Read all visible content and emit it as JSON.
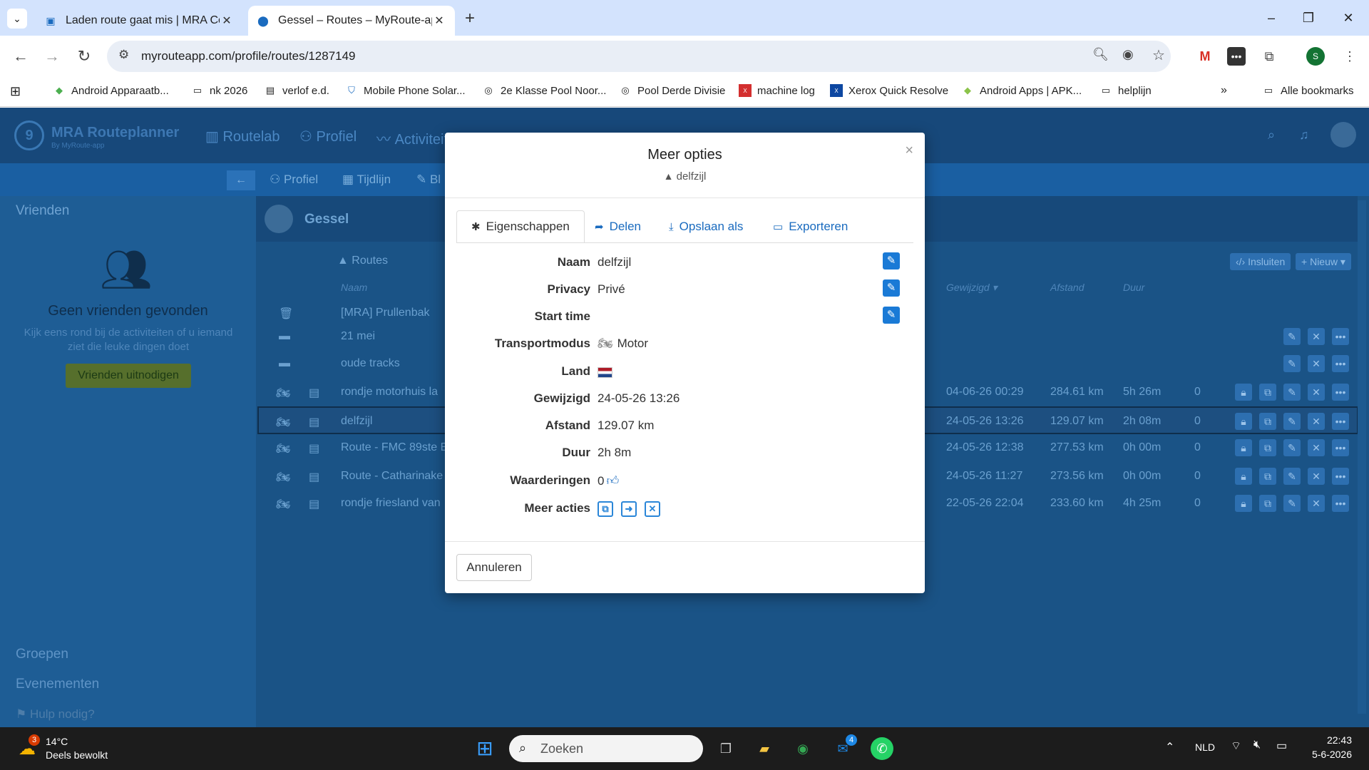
{
  "browser": {
    "tabs": [
      {
        "title": "Laden route gaat mis | MRA Co",
        "active": false
      },
      {
        "title": "Gessel – Routes – MyRoute-app",
        "active": true
      }
    ],
    "url": "myrouteapp.com/profile/routes/1287149",
    "profile_initial": "S",
    "bookmarks": [
      {
        "label": "Android Apparaatb...",
        "icon": "android-icon"
      },
      {
        "label": "nk 2026",
        "icon": "folder-icon"
      },
      {
        "label": "verlof e.d.",
        "icon": "doc-icon"
      },
      {
        "label": "Mobile Phone Solar...",
        "icon": "shield-icon"
      },
      {
        "label": "2e Klasse Pool Noor...",
        "icon": "pool-icon"
      },
      {
        "label": "Pool Derde Divisie",
        "icon": "pool-icon"
      },
      {
        "label": "machine log",
        "icon": "xerox-icon"
      },
      {
        "label": "Xerox Quick Resolve",
        "icon": "xerox-icon"
      },
      {
        "label": "Android Apps | APK...",
        "icon": "android-icon"
      },
      {
        "label": "helplijn",
        "icon": "folder-icon"
      }
    ],
    "all_bookmarks": "Alle bookmarks"
  },
  "app": {
    "logo_title": "MRA Routeplanner",
    "logo_sub": "By MyRoute-app",
    "nav": [
      "Routelab",
      "Profiel",
      "Activiteit"
    ],
    "subnav": [
      "Profiel",
      "Tijdlijn",
      "Bl"
    ],
    "sidebar": {
      "friends_header": "Vrienden",
      "no_friends_title": "Geen vrienden gevonden",
      "no_friends_text": "Kijk eens rond bij de activiteiten of u iemand ziet die leuke dingen doet",
      "invite_button": "Vrienden uitnodigen",
      "groups": "Groepen",
      "events": "Evenementen",
      "help": "Hulp nodig?"
    },
    "profile_name": "Gessel",
    "routes_header": "Routes",
    "toolbar": {
      "embed": "Insluiten",
      "new": "Nieuw"
    },
    "columns": {
      "name": "Naam",
      "modified": "Gewijzigd",
      "distance": "Afstand",
      "duration": "Duur"
    },
    "rows": [
      {
        "name": "[MRA] Prullenbak",
        "type": "trash",
        "modified": "",
        "distance": "",
        "duration": "",
        "likes": ""
      },
      {
        "name": "21 mei",
        "type": "folder",
        "modified": "",
        "distance": "",
        "duration": "",
        "likes": ""
      },
      {
        "name": "oude tracks",
        "type": "folder",
        "modified": "",
        "distance": "",
        "duration": "",
        "likes": ""
      },
      {
        "name": "rondje motorhuis la",
        "type": "route",
        "modified": "04-06-26 00:29",
        "distance": "284.61 km",
        "duration": "5h 26m",
        "likes": "0"
      },
      {
        "name": "delfzijl",
        "type": "route",
        "modified": "24-05-26 13:26",
        "distance": "129.07 km",
        "duration": "2h 08m",
        "likes": "0"
      },
      {
        "name": "Route - FMC 89ste E",
        "type": "route",
        "modified": "24-05-26 12:38",
        "distance": "277.53 km",
        "duration": "0h 00m",
        "likes": "0"
      },
      {
        "name": "Route - Catharinake",
        "type": "route",
        "modified": "24-05-26 11:27",
        "distance": "273.56 km",
        "duration": "0h 00m",
        "likes": "0"
      },
      {
        "name": "rondje friesland van",
        "type": "route",
        "modified": "22-05-26 22:04",
        "distance": "233.60 km",
        "duration": "4h 25m",
        "likes": "0"
      }
    ]
  },
  "modal": {
    "title": "Meer opties",
    "subtitle": "delfzijl",
    "tabs": [
      "Eigenschappen",
      "Delen",
      "Opslaan als",
      "Exporteren"
    ],
    "properties": [
      {
        "label": "Naam",
        "value": "delfzijl",
        "editable": true
      },
      {
        "label": "Privacy",
        "value": "Privé",
        "editable": true
      },
      {
        "label": "Start time",
        "value": "",
        "editable": true
      },
      {
        "label": "Transportmodus",
        "value": "Motor",
        "editable": false
      },
      {
        "label": "Land",
        "value": "",
        "editable": false
      },
      {
        "label": "Gewijzigd",
        "value": "24-05-26 13:26",
        "editable": false
      },
      {
        "label": "Afstand",
        "value": "129.07 km",
        "editable": false
      },
      {
        "label": "Duur",
        "value": "2h 8m",
        "editable": false
      },
      {
        "label": "Waarderingen",
        "value": "0",
        "editable": false
      },
      {
        "label": "Meer acties",
        "value": "",
        "editable": false
      }
    ],
    "cancel": "Annuleren"
  },
  "taskbar": {
    "temp": "14°C",
    "weather": "Deels bewolkt",
    "weather_badge": "3",
    "search_placeholder": "Zoeken",
    "lang": "NLD",
    "time": "22:43",
    "date": "5-6-2026",
    "mail_badge": "4"
  },
  "colors": {
    "accent": "#1a7ad6",
    "app_bg": "#17487a",
    "modal_bg": "#ffffff"
  }
}
